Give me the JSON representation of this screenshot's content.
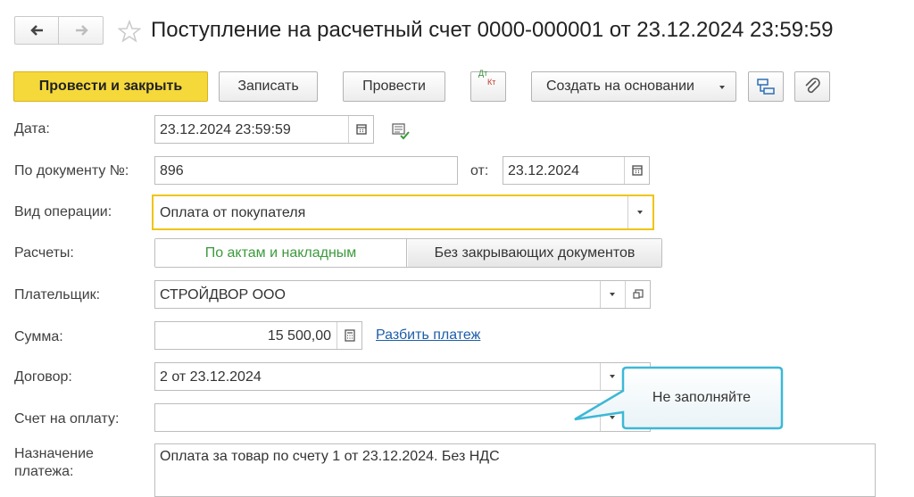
{
  "header": {
    "title": "Поступление на расчетный счет 0000-000001 от 23.12.2024 23:59:59",
    "back_icon": "arrow-left-icon",
    "forward_icon": "arrow-right-icon",
    "favorite_icon": "star-icon"
  },
  "toolbar": {
    "post_close": "Провести и закрыть",
    "save": "Записать",
    "post": "Провести",
    "dt": "Дт",
    "kt": "Кт",
    "create_based": "Создать на основании",
    "structure_icon": "document-structure-icon",
    "attach_icon": "paperclip-icon"
  },
  "form": {
    "date_label": "Дата:",
    "date_value": "23.12.2024 23:59:59",
    "doc_no_label": "По документу №:",
    "doc_no_value": "896",
    "from_label": "от:",
    "from_value": "23.12.2024",
    "op_type_label": "Вид операции:",
    "op_type_value": "Оплата от покупателя",
    "settlements_label": "Расчеты:",
    "settlements_opt1": "По актам и накладным",
    "settlements_opt2": "Без закрывающих документов",
    "payer_label": "Плательщик:",
    "payer_value": "СТРОЙДВОР ООО",
    "amount_label": "Сумма:",
    "amount_value": "15 500,00",
    "split_link": "Разбить платеж",
    "contract_label": "Договор:",
    "contract_value": "2 от 23.12.2024",
    "invoice_label": "Счет на оплату:",
    "invoice_value": "",
    "purpose_label_1": "Назначение",
    "purpose_label_2": "платежа:",
    "purpose_value": "Оплата за товар по счету 1 от 23.12.2024. Без НДС"
  },
  "callout": {
    "text": "Не заполняйте"
  },
  "colors": {
    "primary_button": "#f5d93b",
    "focus_border": "#f0c40f",
    "link": "#1e5fa8",
    "selected_green": "#3c9a3c",
    "callout_border": "#3db8d6"
  }
}
